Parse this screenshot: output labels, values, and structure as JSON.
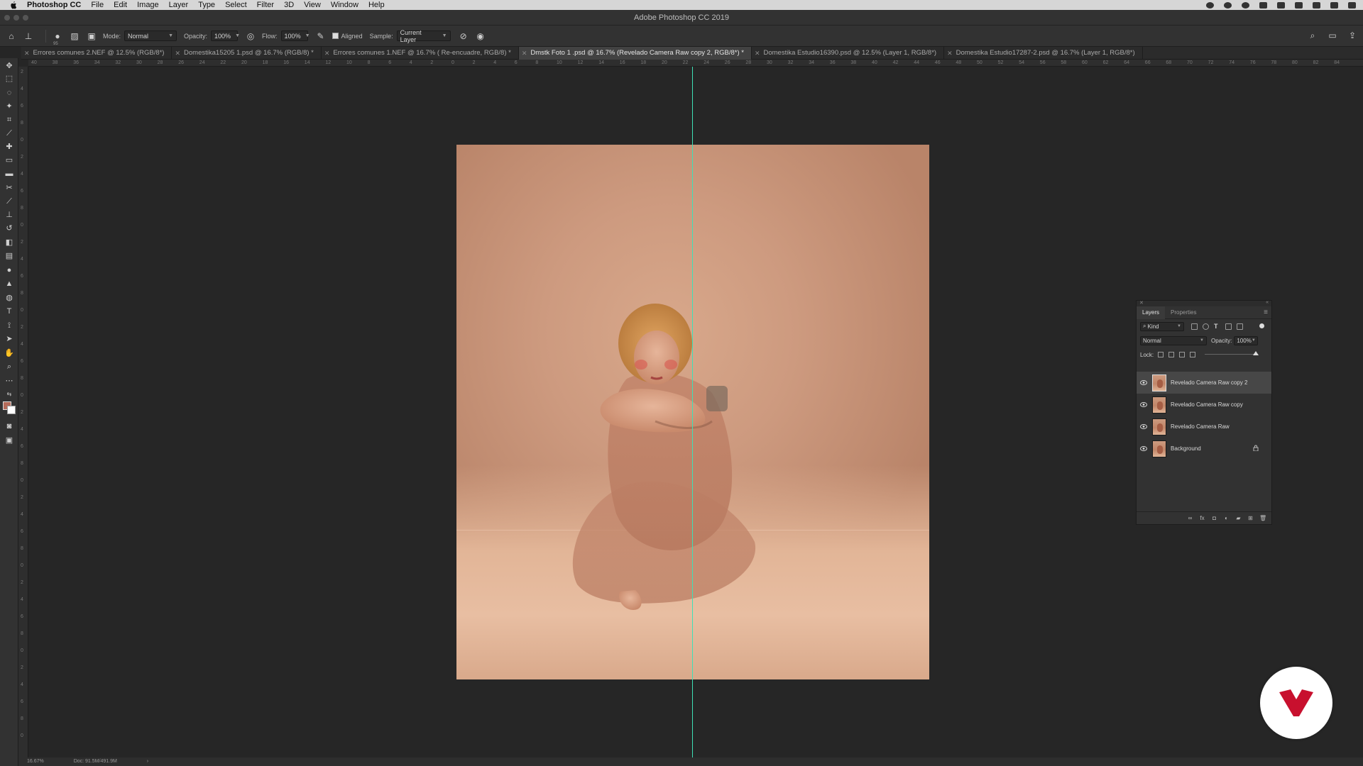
{
  "menubar": {
    "app_name": "Photoshop CC",
    "menus": [
      "File",
      "Edit",
      "Image",
      "Layer",
      "Type",
      "Select",
      "Filter",
      "3D",
      "View",
      "Window",
      "Help"
    ]
  },
  "window": {
    "title": "Adobe Photoshop CC 2019"
  },
  "options": {
    "brush_size": "95",
    "mode_label": "Mode:",
    "mode_value": "Normal",
    "opacity_label": "Opacity:",
    "opacity_value": "100%",
    "flow_label": "Flow:",
    "flow_value": "100%",
    "aligned_label": "Aligned",
    "sample_label": "Sample:",
    "sample_value": "Current Layer"
  },
  "tabs": [
    {
      "label": "Errores comunes 2.NEF @ 12.5% (RGB/8*)",
      "active": false
    },
    {
      "label": "Domestika15205 1.psd @ 16.7% (RGB/8) *",
      "active": false
    },
    {
      "label": "Errores comunes 1.NEF @ 16.7% ( Re-encuadre, RGB/8) *",
      "active": false
    },
    {
      "label": "Dmstk Foto 1 .psd @ 16.7% (Revelado Camera Raw copy 2, RGB/8*) *",
      "active": true
    },
    {
      "label": "Domestika Estudio16390.psd @ 12.5% (Layer 1, RGB/8*)",
      "active": false
    },
    {
      "label": "Domestika Estudio17287-2.psd @ 16.7% (Layer 1, RGB/8*)",
      "active": false
    }
  ],
  "ruler": {
    "top": [
      "40",
      "38",
      "36",
      "34",
      "32",
      "30",
      "28",
      "26",
      "24",
      "22",
      "20",
      "18",
      "16",
      "14",
      "12",
      "10",
      "8",
      "6",
      "4",
      "2",
      "0",
      "2",
      "4",
      "6",
      "8",
      "10",
      "12",
      "14",
      "16",
      "18",
      "20",
      "22",
      "24",
      "26",
      "28",
      "30",
      "32",
      "34",
      "36",
      "38",
      "40",
      "42",
      "44",
      "46",
      "48",
      "50",
      "52",
      "54",
      "56",
      "58",
      "60",
      "62",
      "64",
      "66",
      "68",
      "70",
      "72",
      "74",
      "76",
      "78",
      "80",
      "82",
      "84"
    ],
    "left": [
      "2",
      "4",
      "6",
      "8",
      "0",
      "2",
      "4",
      "6",
      "8",
      "0",
      "2",
      "4",
      "6",
      "8",
      "0",
      "2",
      "4",
      "6",
      "8",
      "0",
      "2",
      "4",
      "6",
      "8",
      "0",
      "2",
      "4",
      "6",
      "8",
      "0",
      "2",
      "4",
      "6",
      "8",
      "0",
      "2",
      "4",
      "6",
      "8",
      "0"
    ]
  },
  "layers_panel": {
    "tab_layers": "Layers",
    "tab_properties": "Properties",
    "filter_kind": "Kind",
    "blend_mode": "Normal",
    "opacity_label": "Opacity:",
    "opacity_value": "100%",
    "lock_label": "Lock:",
    "layers": [
      {
        "name": "Revelado Camera Raw copy 2",
        "selected": true,
        "locked": false
      },
      {
        "name": "Revelado Camera Raw copy",
        "selected": false,
        "locked": false
      },
      {
        "name": "Revelado Camera Raw",
        "selected": false,
        "locked": false
      },
      {
        "name": "Background",
        "selected": false,
        "locked": true
      }
    ]
  },
  "status": {
    "zoom": "16.67%",
    "doc_size": "Doc: 91.5M/491.9M"
  },
  "colors": {
    "guide": "#3ee0b6",
    "foreground": "#b46b5a",
    "background": "#ffffff",
    "brand": "#c8102e"
  }
}
